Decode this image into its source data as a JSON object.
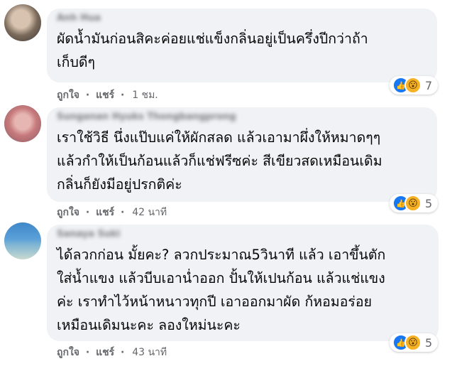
{
  "comments": [
    {
      "author": "Anh Hua",
      "lines": [
        "ผัดน้ำมันก่อนสิคะค่อยแช่แข็งกลิ่นอยู่เป็นครึ่งปีกว่าถ้า",
        "เก็บดีๆ"
      ],
      "like": "ถูกใจ",
      "share": "แชร์",
      "time": "1 ชม.",
      "reaction_count": "7",
      "reaction_icons": [
        "like-icon",
        "wow-icon"
      ]
    },
    {
      "author": "Sunganan Hyuks Thongbangprong",
      "lines": [
        "เราใช้วิธี นึ่งแป๊บแค่ให้ผักสลด แล้วเอามาผึ่งให้หมาดๆๆ",
        "แล้วกำให้เป็นก้อนแล้วก็แช่ฟรีซค่ะ สีเขียวสดเหมือนเดิม",
        "กลิ่นก็ยังมีอยู่ปรกติค่ะ"
      ],
      "like": "ถูกใจ",
      "share": "แชร์",
      "time": "42 นาที",
      "reaction_count": "5",
      "reaction_icons": [
        "like-icon",
        "wow-icon"
      ]
    },
    {
      "author": "Sanaya Suki",
      "lines": [
        "ได้ลวกก่อน มั้ยคะ? ลวกประมาณ5วินาที แล้ว เอาขึ้นตัก",
        "ใส่น้ำแขง แล้วบีบเอาน่ำออก ปั้นให้เปนก้อน แล้วแช่แขง",
        "ค่ะ เราทำไว้หน้าหนาวทุกปี เอาออกมาผัด ก้หอมอร่อย",
        "เหมือนเดิมนะคะ ลองใหม่นะคะ"
      ],
      "like": "ถูกใจ",
      "share": "แชร์",
      "time": "43 นาที",
      "reaction_count": "5",
      "reaction_icons": [
        "like-icon",
        "wow-icon"
      ]
    }
  ],
  "separator": "·"
}
